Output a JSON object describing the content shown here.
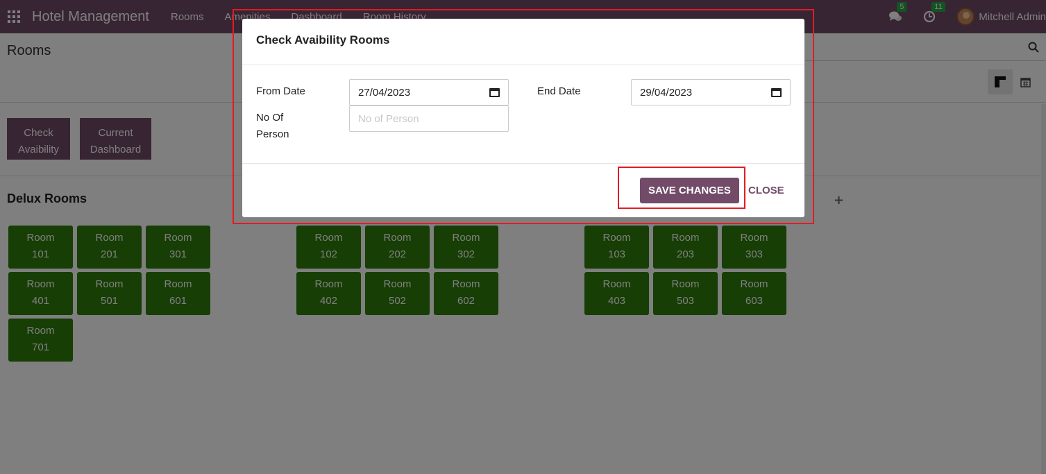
{
  "navbar": {
    "brand": "Hotel Management",
    "menu": [
      "Rooms",
      "Amenities",
      "Dashboard",
      "Room History"
    ],
    "messages_count": "5",
    "activities_count": "11",
    "user_name": "Mitchell Admin"
  },
  "control_panel": {
    "breadcrumb": "Rooms"
  },
  "actions": {
    "check_label_1": "Check",
    "check_label_2": "Avaibility",
    "dash_label_1": "Current",
    "dash_label_2": "Dashboard"
  },
  "group": {
    "title": "Delux Rooms",
    "plus": "+"
  },
  "rooms": {
    "label": "Room",
    "col1": [
      "101",
      "201",
      "301",
      "401",
      "501",
      "601",
      "701"
    ],
    "col2": [
      "102",
      "202",
      "302",
      "402",
      "502",
      "602"
    ],
    "col3": [
      "103",
      "203",
      "303",
      "403",
      "503",
      "603"
    ]
  },
  "modal": {
    "title": "Check Avaibility Rooms",
    "from_date_label": "From Date",
    "from_date_value": "27/04/2023",
    "end_date_label": "End Date",
    "end_date_value": "29/04/2023",
    "persons_label_1": "No Of",
    "persons_label_2": "Person",
    "persons_placeholder": "No of Person",
    "save_label": "SAVE CHANGES",
    "close_label": "CLOSE"
  },
  "colors": {
    "brand": "#714b67",
    "room_green": "#2e7d0a",
    "highlight": "#e31b23"
  }
}
